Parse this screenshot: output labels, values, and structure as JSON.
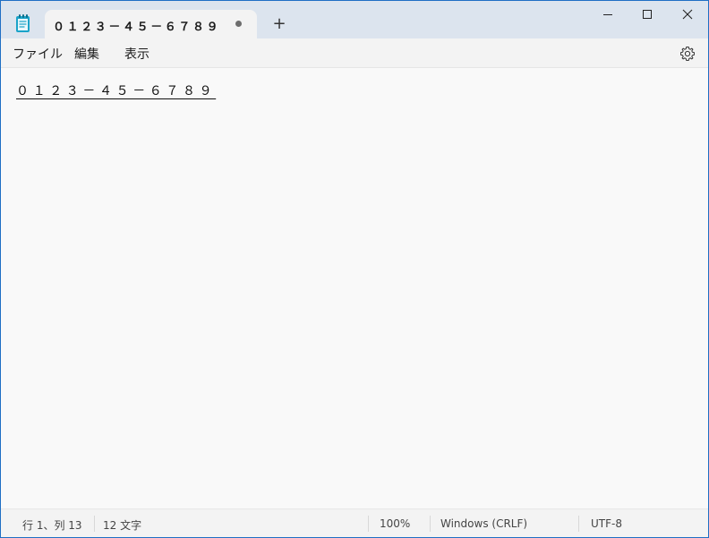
{
  "tab": {
    "title": "０１２３－４５－６７８９",
    "modified_indicator": "unsaved-dot",
    "new_tab_label": "+"
  },
  "icons": {
    "app": "notepad-icon",
    "minimize": "minimize-icon",
    "maximize": "maximize-icon",
    "close": "close-icon",
    "settings": "gear-icon"
  },
  "menu": {
    "file": "ファイル",
    "edit": "編集",
    "view": "表示"
  },
  "editor": {
    "content": "０１２３－４５－６７８９"
  },
  "status": {
    "position": "行 1、列 13",
    "char_count": "12 文字",
    "zoom": "100%",
    "line_ending": "Windows (CRLF)",
    "encoding": "UTF-8"
  },
  "colors": {
    "window_border": "#1f6fc4",
    "titlebar_bg": "#dce4ee",
    "icon_accent": "#1aa3c9"
  }
}
